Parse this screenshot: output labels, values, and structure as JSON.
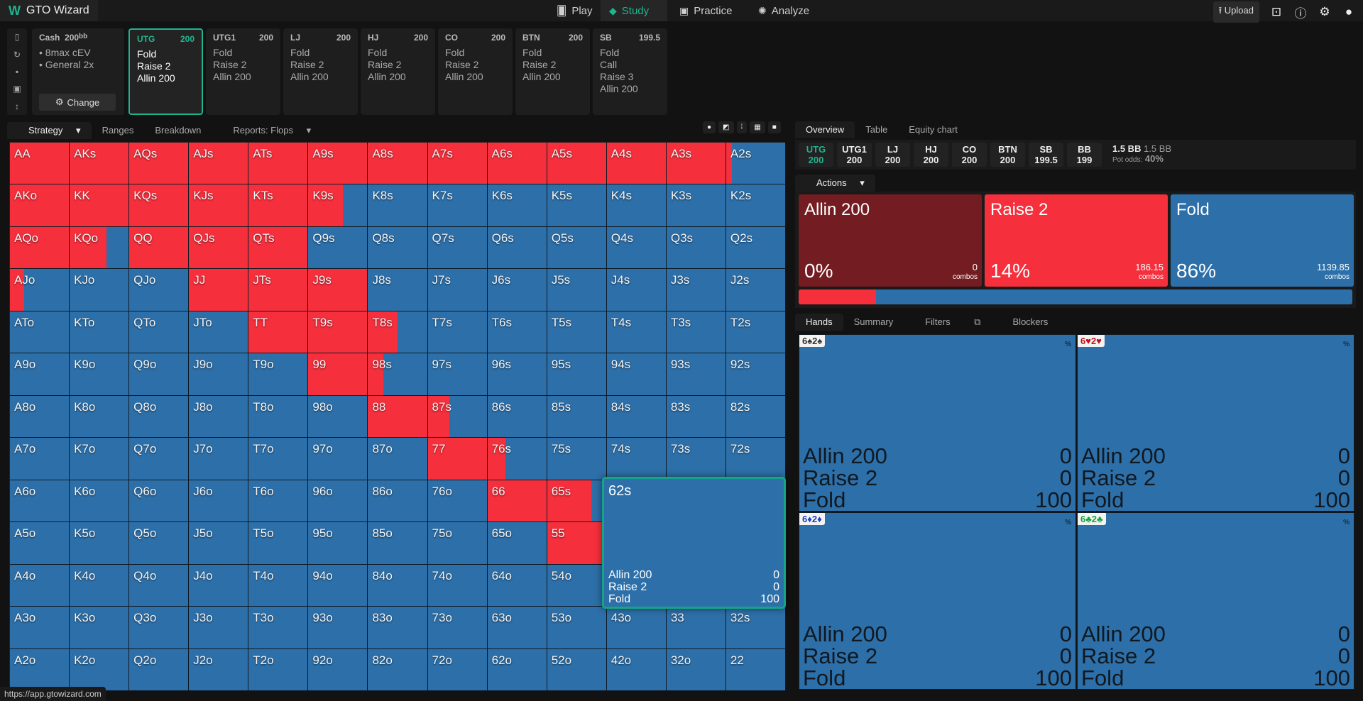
{
  "app": {
    "title": "GTO Wizard",
    "status_url": "https://app.gtowizard.com"
  },
  "nav": [
    {
      "label": "Play",
      "icon": "cards-icon"
    },
    {
      "label": "Study",
      "icon": "graduation-cap-icon",
      "active": true
    },
    {
      "label": "Practice",
      "icon": "gamepad-icon"
    },
    {
      "label": "Analyze",
      "icon": "lightbulb-icon"
    }
  ],
  "toolbar": {
    "upload": "Upload"
  },
  "config": {
    "game": "Cash",
    "stack": "200",
    "stack_unit": "bb",
    "options": [
      "8max cEV",
      "General 2x"
    ],
    "change": "Change"
  },
  "positions_cards": [
    {
      "pos": "UTG",
      "stack": "200",
      "actions": [
        "Fold",
        "Raise 2",
        "Allin 200"
      ],
      "selected": true
    },
    {
      "pos": "UTG1",
      "stack": "200",
      "actions": [
        "Fold",
        "Raise 2",
        "Allin 200"
      ]
    },
    {
      "pos": "LJ",
      "stack": "200",
      "actions": [
        "Fold",
        "Raise 2",
        "Allin 200"
      ]
    },
    {
      "pos": "HJ",
      "stack": "200",
      "actions": [
        "Fold",
        "Raise 2",
        "Allin 200"
      ]
    },
    {
      "pos": "CO",
      "stack": "200",
      "actions": [
        "Fold",
        "Raise 2",
        "Allin 200"
      ]
    },
    {
      "pos": "BTN",
      "stack": "200",
      "actions": [
        "Fold",
        "Raise 2",
        "Allin 200"
      ]
    },
    {
      "pos": "SB",
      "stack": "199.5",
      "actions": [
        "Fold",
        "Call",
        "Raise 3",
        "Allin 200"
      ]
    }
  ],
  "left_tabs": [
    "Strategy",
    "Ranges",
    "Breakdown",
    "Reports: Flops"
  ],
  "grid": {
    "ranks": [
      "A",
      "K",
      "Q",
      "J",
      "T",
      "9",
      "8",
      "7",
      "6",
      "5",
      "4",
      "3",
      "2"
    ],
    "colors": {
      "raise": "#f52f3c",
      "fold": "#2d6fa8",
      "allin": "#731c21"
    },
    "raise_freq": {
      "AA": 1,
      "AKs": 1,
      "AQs": 1,
      "AJs": 1,
      "ATs": 1,
      "A9s": 1,
      "A8s": 1,
      "A7s": 1,
      "A6s": 1,
      "A5s": 1,
      "A4s": 1,
      "A3s": 1,
      "A2s": 0.1,
      "AKo": 1,
      "KK": 1,
      "KQs": 1,
      "KJs": 1,
      "KTs": 1,
      "K9s": 0.58,
      "AQo": 1,
      "KQo": 0.62,
      "QQ": 1,
      "QJs": 1,
      "QTs": 1,
      "AJo": 0.24,
      "JJ": 1,
      "JTs": 1,
      "J9s": 1,
      "TT": 1,
      "T9s": 1,
      "T8s": 0.5,
      "99": 1,
      "98s": 0.26,
      "88": 1,
      "87s": 0.37,
      "77": 1,
      "76s": 0.3,
      "66": 1,
      "65s": 0.75,
      "55": 1
    }
  },
  "tooltip": {
    "hand": "62s",
    "rows": [
      {
        "label": "Allin 200",
        "value": "0"
      },
      {
        "label": "Raise 2",
        "value": "0"
      },
      {
        "label": "Fold",
        "value": "100"
      }
    ]
  },
  "right_tabs": [
    "Overview",
    "Table",
    "Equity chart"
  ],
  "positions": [
    {
      "pos": "UTG",
      "stack": "200",
      "active": true
    },
    {
      "pos": "UTG1",
      "stack": "200"
    },
    {
      "pos": "LJ",
      "stack": "200"
    },
    {
      "pos": "HJ",
      "stack": "200"
    },
    {
      "pos": "CO",
      "stack": "200"
    },
    {
      "pos": "BTN",
      "stack": "200"
    },
    {
      "pos": "SB",
      "stack": "199.5"
    },
    {
      "pos": "BB",
      "stack": "199"
    }
  ],
  "pot": {
    "pot": "1.5 BB",
    "pot2": "1.5 BB",
    "odds_label": "Pot odds:",
    "odds": "40%"
  },
  "actions_tab": "Actions",
  "actions": [
    {
      "name": "Allin 200",
      "pct": "0%",
      "combos": "0",
      "color": "#731c21",
      "freq": 0
    },
    {
      "name": "Raise 2",
      "pct": "14%",
      "combos": "186.15",
      "color": "#f52f3c",
      "freq": 14
    },
    {
      "name": "Fold",
      "pct": "86%",
      "combos": "1139.85",
      "color": "#2d6fa8",
      "freq": 86
    }
  ],
  "combos_label": "combos",
  "hand_tabs": [
    "Hands",
    "Summary",
    "Filters",
    "Blockers"
  ],
  "hand_combos": [
    {
      "label": "6♠2♠",
      "color": "#333333",
      "rows": [
        {
          "label": "Allin 200",
          "value": "0"
        },
        {
          "label": "Raise 2",
          "value": "0"
        },
        {
          "label": "Fold",
          "value": "100"
        }
      ]
    },
    {
      "label": "6♥2♥",
      "color": "#c0121c",
      "rows": [
        {
          "label": "Allin 200",
          "value": "0"
        },
        {
          "label": "Raise 2",
          "value": "0"
        },
        {
          "label": "Fold",
          "value": "100"
        }
      ]
    },
    {
      "label": "6♦2♦",
      "color": "#1e3fc8",
      "rows": [
        {
          "label": "Allin 200",
          "value": "0"
        },
        {
          "label": "Raise 2",
          "value": "0"
        },
        {
          "label": "Fold",
          "value": "100"
        }
      ]
    },
    {
      "label": "6♣2♣",
      "color": "#16a33a",
      "rows": [
        {
          "label": "Allin 200",
          "value": "0"
        },
        {
          "label": "Raise 2",
          "value": "0"
        },
        {
          "label": "Fold",
          "value": "100"
        }
      ]
    }
  ],
  "percent_symbol": "%"
}
